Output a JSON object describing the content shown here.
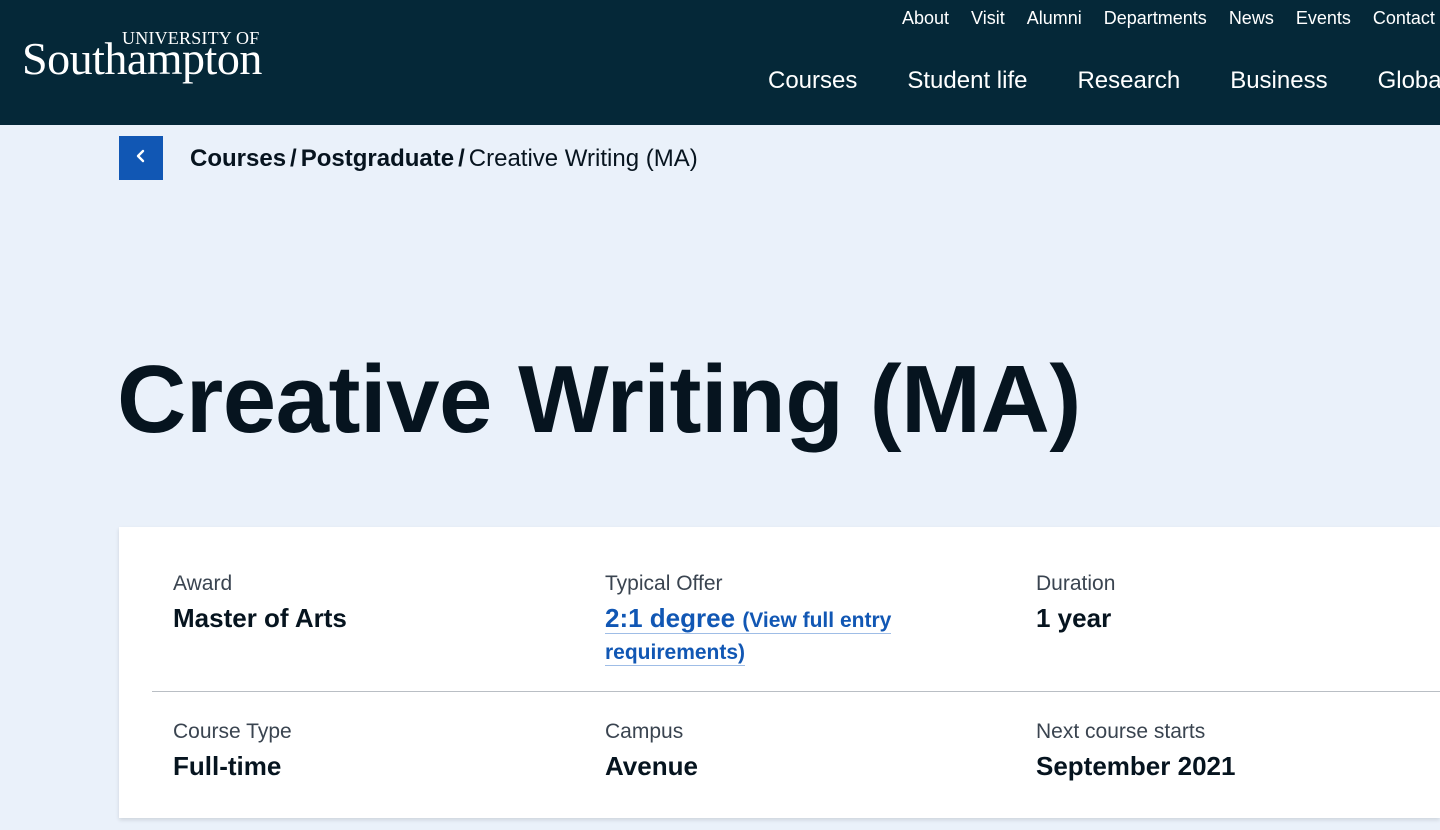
{
  "header": {
    "logo": {
      "line1": "UNIVERSITY OF",
      "line2": "Southampton"
    },
    "utility_nav": [
      "About",
      "Visit",
      "Alumni",
      "Departments",
      "News",
      "Events",
      "Contact"
    ],
    "main_nav": [
      "Courses",
      "Student life",
      "Research",
      "Business",
      "Global"
    ]
  },
  "breadcrumb": {
    "back_icon": "chevron-left-icon",
    "items": [
      "Courses",
      "Postgraduate",
      "Creative Writing (MA)"
    ],
    "separator": "/"
  },
  "page": {
    "title": "Creative Writing (MA)"
  },
  "course_info": {
    "award": {
      "label": "Award",
      "value": "Master of Arts"
    },
    "typical_offer": {
      "label": "Typical Offer",
      "value": "2:1 degree",
      "link_text": "(View full entry requirements)"
    },
    "duration": {
      "label": "Duration",
      "value": "1 year"
    },
    "course_type": {
      "label": "Course Type",
      "value": "Full-time"
    },
    "campus": {
      "label": "Campus",
      "value": "Avenue"
    },
    "next_start": {
      "label": "Next course starts",
      "value": "September 2021"
    }
  },
  "colors": {
    "header_bg": "#052838",
    "page_bg": "#eaf1fa",
    "accent_blue": "#1157b4",
    "text_dark": "#06141f"
  }
}
